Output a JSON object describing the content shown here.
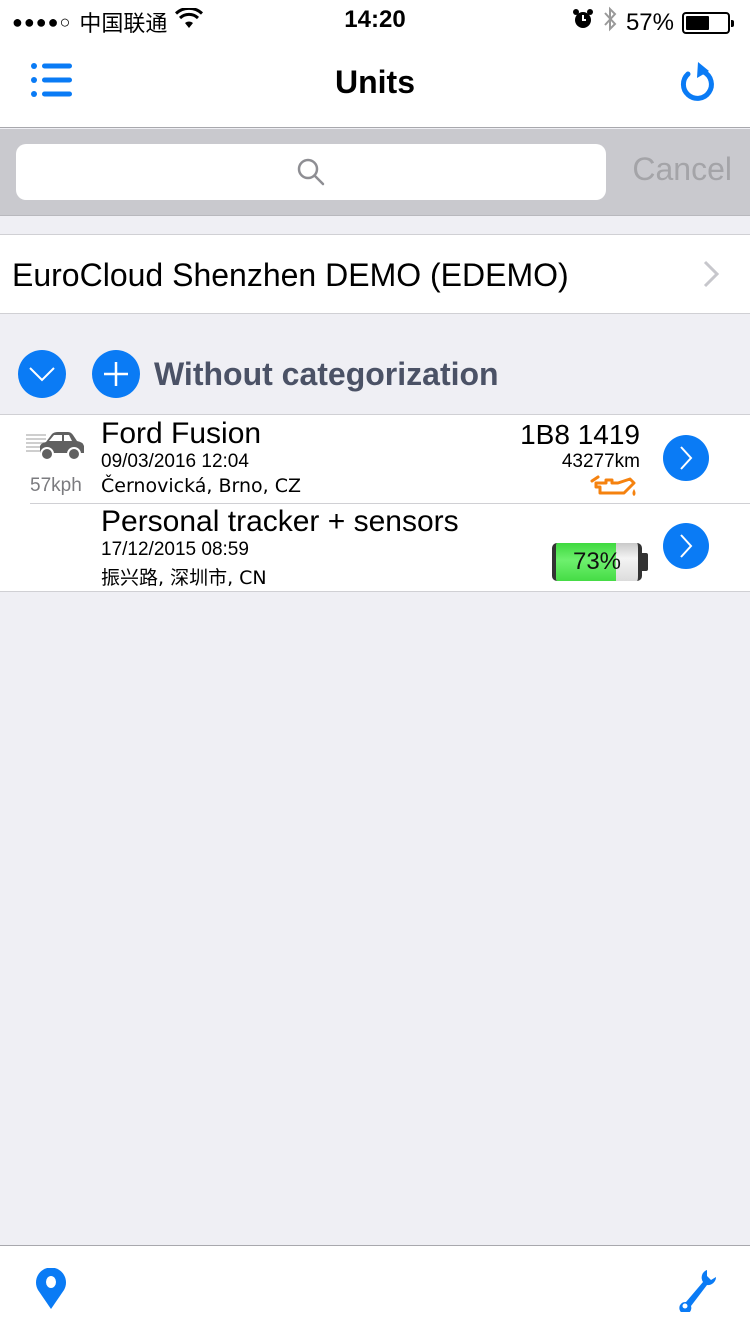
{
  "status_bar": {
    "signal": "●●●●○",
    "carrier": "中国联通",
    "time": "14:20",
    "battery_percent_label": "57%",
    "battery_level": 0.57
  },
  "nav": {
    "title": "Units",
    "left_icon": "list-menu-icon",
    "right_icon": "refresh-icon"
  },
  "search": {
    "placeholder": "",
    "value": "",
    "cancel_label": "Cancel"
  },
  "account": {
    "name": "EuroCloud Shenzhen DEMO (EDEMO)"
  },
  "group": {
    "title": "Without categorization"
  },
  "units": [
    {
      "name": "Ford Fusion",
      "time": "09/03/2016 12:04",
      "address": "Černovická, Brno, CZ",
      "speed": "57kph",
      "plate": "1B8 1419",
      "mileage": "43277km",
      "icon": "car-moving-icon",
      "sensor_icon": "oil-can-warning-icon"
    },
    {
      "name": "Personal tracker + sensors",
      "time": "17/12/2015 08:59",
      "address": "振兴路, 深圳市, CN",
      "battery_label": "73%",
      "battery_level": 0.73
    }
  ],
  "colors": {
    "accent": "#0a7bf5",
    "warning": "#f5820f",
    "battery_green": "#4ee04e",
    "group_title": "#4b5266"
  },
  "tab_bar": {
    "left_icon": "map-pin-icon",
    "right_icon": "wrench-icon"
  }
}
